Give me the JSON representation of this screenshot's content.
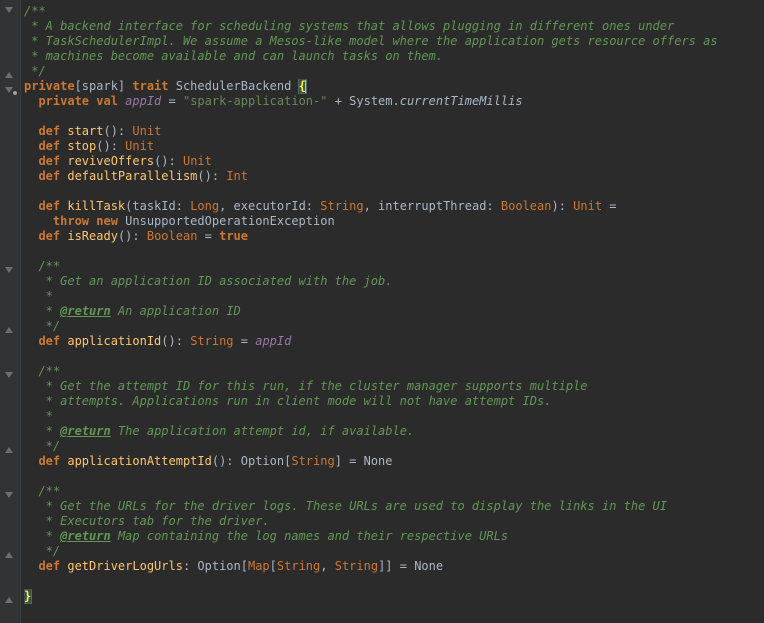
{
  "editor": {
    "lines": [
      [
        {
          "c": "doc",
          "t": "/**"
        }
      ],
      [
        {
          "c": "doc",
          "t": " * A backend interface for scheduling systems that allows plugging in different ones under"
        }
      ],
      [
        {
          "c": "doc",
          "t": " * TaskSchedulerImpl. We assume a Mesos-like model where the application gets resource offers as"
        }
      ],
      [
        {
          "c": "doc",
          "t": " * machines become available and can launch tasks on them."
        }
      ],
      [
        {
          "c": "doc",
          "t": " */"
        }
      ],
      [
        {
          "c": "kw",
          "t": "private"
        },
        {
          "c": "",
          "t": "[spark] "
        },
        {
          "c": "kw",
          "t": "trait "
        },
        {
          "c": "",
          "t": "SchedulerBackend "
        },
        {
          "c": "brace-hl",
          "t": "{"
        }
      ],
      [
        {
          "c": "",
          "t": "  "
        },
        {
          "c": "kw",
          "t": "private val "
        },
        {
          "c": "fld",
          "t": "appId"
        },
        {
          "c": "",
          "t": " = "
        },
        {
          "c": "str",
          "t": "\"spark-application-\""
        },
        {
          "c": "",
          "t": " + System."
        },
        {
          "c": "it",
          "t": "currentTimeMillis"
        }
      ],
      [
        {
          "c": "",
          "t": ""
        }
      ],
      [
        {
          "c": "",
          "t": "  "
        },
        {
          "c": "kw",
          "t": "def "
        },
        {
          "c": "fn",
          "t": "start"
        },
        {
          "c": "",
          "t": "(): "
        },
        {
          "c": "ty",
          "t": "Unit"
        }
      ],
      [
        {
          "c": "",
          "t": "  "
        },
        {
          "c": "kw",
          "t": "def "
        },
        {
          "c": "fn",
          "t": "stop"
        },
        {
          "c": "",
          "t": "(): "
        },
        {
          "c": "ty",
          "t": "Unit"
        }
      ],
      [
        {
          "c": "",
          "t": "  "
        },
        {
          "c": "kw",
          "t": "def "
        },
        {
          "c": "fn",
          "t": "reviveOffers"
        },
        {
          "c": "",
          "t": "(): "
        },
        {
          "c": "ty",
          "t": "Unit"
        }
      ],
      [
        {
          "c": "",
          "t": "  "
        },
        {
          "c": "kw",
          "t": "def "
        },
        {
          "c": "fn",
          "t": "defaultParallelism"
        },
        {
          "c": "",
          "t": "(): "
        },
        {
          "c": "ty",
          "t": "Int"
        }
      ],
      [
        {
          "c": "",
          "t": ""
        }
      ],
      [
        {
          "c": "",
          "t": "  "
        },
        {
          "c": "kw",
          "t": "def "
        },
        {
          "c": "fn",
          "t": "killTask"
        },
        {
          "c": "",
          "t": "(taskId: "
        },
        {
          "c": "ty",
          "t": "Long"
        },
        {
          "c": "",
          "t": ", executorId: "
        },
        {
          "c": "ty",
          "t": "String"
        },
        {
          "c": "",
          "t": ", interruptThread: "
        },
        {
          "c": "ty",
          "t": "Boolean"
        },
        {
          "c": "",
          "t": "): "
        },
        {
          "c": "ty",
          "t": "Unit"
        },
        {
          "c": "",
          "t": " ="
        }
      ],
      [
        {
          "c": "",
          "t": "    "
        },
        {
          "c": "kw",
          "t": "throw new "
        },
        {
          "c": "",
          "t": "UnsupportedOperationException"
        }
      ],
      [
        {
          "c": "",
          "t": "  "
        },
        {
          "c": "kw",
          "t": "def "
        },
        {
          "c": "fn",
          "t": "isReady"
        },
        {
          "c": "",
          "t": "(): "
        },
        {
          "c": "ty",
          "t": "Boolean"
        },
        {
          "c": "",
          "t": " = "
        },
        {
          "c": "kw",
          "t": "true"
        }
      ],
      [
        {
          "c": "",
          "t": ""
        }
      ],
      [
        {
          "c": "",
          "t": "  "
        },
        {
          "c": "doc",
          "t": "/**"
        }
      ],
      [
        {
          "c": "",
          "t": "  "
        },
        {
          "c": "doc",
          "t": " * Get an application ID associated with the job."
        }
      ],
      [
        {
          "c": "",
          "t": "  "
        },
        {
          "c": "doc",
          "t": " *"
        }
      ],
      [
        {
          "c": "",
          "t": "  "
        },
        {
          "c": "doc",
          "t": " * "
        },
        {
          "c": "tag",
          "t": "@return"
        },
        {
          "c": "doc",
          "t": " An application ID"
        }
      ],
      [
        {
          "c": "",
          "t": "  "
        },
        {
          "c": "doc",
          "t": " */"
        }
      ],
      [
        {
          "c": "",
          "t": "  "
        },
        {
          "c": "kw",
          "t": "def "
        },
        {
          "c": "fn",
          "t": "applicationId"
        },
        {
          "c": "",
          "t": "(): "
        },
        {
          "c": "ty",
          "t": "String"
        },
        {
          "c": "",
          "t": " = "
        },
        {
          "c": "fld",
          "t": "appId"
        }
      ],
      [
        {
          "c": "",
          "t": ""
        }
      ],
      [
        {
          "c": "",
          "t": "  "
        },
        {
          "c": "doc",
          "t": "/**"
        }
      ],
      [
        {
          "c": "",
          "t": "  "
        },
        {
          "c": "doc",
          "t": " * Get the attempt ID for this run, if the cluster manager supports multiple"
        }
      ],
      [
        {
          "c": "",
          "t": "  "
        },
        {
          "c": "doc",
          "t": " * attempts. Applications run in client mode will not have attempt IDs."
        }
      ],
      [
        {
          "c": "",
          "t": "  "
        },
        {
          "c": "doc",
          "t": " *"
        }
      ],
      [
        {
          "c": "",
          "t": "  "
        },
        {
          "c": "doc",
          "t": " * "
        },
        {
          "c": "tag",
          "t": "@return"
        },
        {
          "c": "doc",
          "t": " The application attempt id, if available."
        }
      ],
      [
        {
          "c": "",
          "t": "  "
        },
        {
          "c": "doc",
          "t": " */"
        }
      ],
      [
        {
          "c": "",
          "t": "  "
        },
        {
          "c": "kw",
          "t": "def "
        },
        {
          "c": "fn",
          "t": "applicationAttemptId"
        },
        {
          "c": "",
          "t": "(): Option["
        },
        {
          "c": "ty",
          "t": "String"
        },
        {
          "c": "",
          "t": "] = None"
        }
      ],
      [
        {
          "c": "",
          "t": ""
        }
      ],
      [
        {
          "c": "",
          "t": "  "
        },
        {
          "c": "doc",
          "t": "/**"
        }
      ],
      [
        {
          "c": "",
          "t": "  "
        },
        {
          "c": "doc",
          "t": " * Get the URLs for the driver logs. These URLs are used to display the links in the UI"
        }
      ],
      [
        {
          "c": "",
          "t": "  "
        },
        {
          "c": "doc",
          "t": " * Executors tab for the driver."
        }
      ],
      [
        {
          "c": "",
          "t": "  "
        },
        {
          "c": "doc",
          "t": " * "
        },
        {
          "c": "tag",
          "t": "@return"
        },
        {
          "c": "doc",
          "t": " Map containing the log names and their respective URLs"
        }
      ],
      [
        {
          "c": "",
          "t": "  "
        },
        {
          "c": "doc",
          "t": " */"
        }
      ],
      [
        {
          "c": "",
          "t": "  "
        },
        {
          "c": "kw",
          "t": "def "
        },
        {
          "c": "fn",
          "t": "getDriverLogUrls"
        },
        {
          "c": "",
          "t": ": Option["
        },
        {
          "c": "ty",
          "t": "Map"
        },
        {
          "c": "",
          "t": "["
        },
        {
          "c": "ty",
          "t": "String"
        },
        {
          "c": "",
          "t": ", "
        },
        {
          "c": "ty",
          "t": "String"
        },
        {
          "c": "",
          "t": "]] = None"
        }
      ],
      [
        {
          "c": "",
          "t": ""
        }
      ],
      [
        {
          "c": "brace-hl",
          "t": "}"
        }
      ]
    ]
  },
  "colors": {
    "background": "#2b2b2b",
    "gutter": "#313335",
    "doc_comment": "#629755",
    "keyword": "#cc7832",
    "string": "#6a8759",
    "function": "#ffc66d",
    "field": "#9876aa",
    "default_text": "#a9b7c6"
  }
}
